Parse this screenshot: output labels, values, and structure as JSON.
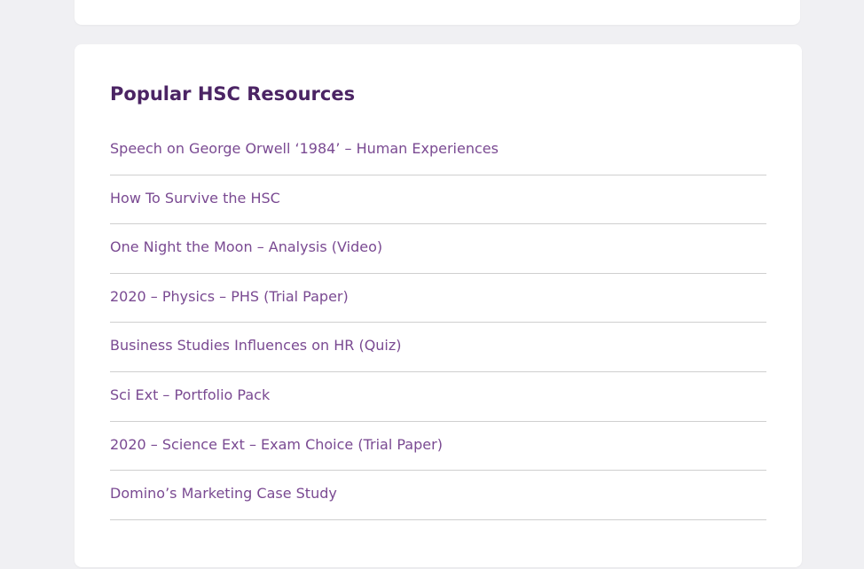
{
  "widget": {
    "title": "Popular HSC Resources",
    "items": [
      {
        "label": "Speech on George Orwell ‘1984’ – Human Experiences"
      },
      {
        "label": "How To Survive the HSC"
      },
      {
        "label": "One Night the Moon – Analysis (Video)"
      },
      {
        "label": "2020 – Physics – PHS (Trial Paper)"
      },
      {
        "label": "Business Studies Influences on HR (Quiz)"
      },
      {
        "label": "Sci Ext – Portfolio Pack"
      },
      {
        "label": "2020 – Science Ext – Exam Choice (Trial Paper)"
      },
      {
        "label": "Domino’s Marketing Case Study"
      }
    ]
  },
  "colors": {
    "title": "#4b2464",
    "link": "#7a4a92",
    "background": "#f0f0f3",
    "card": "#ffffff",
    "divider": "#cfcfcf"
  }
}
